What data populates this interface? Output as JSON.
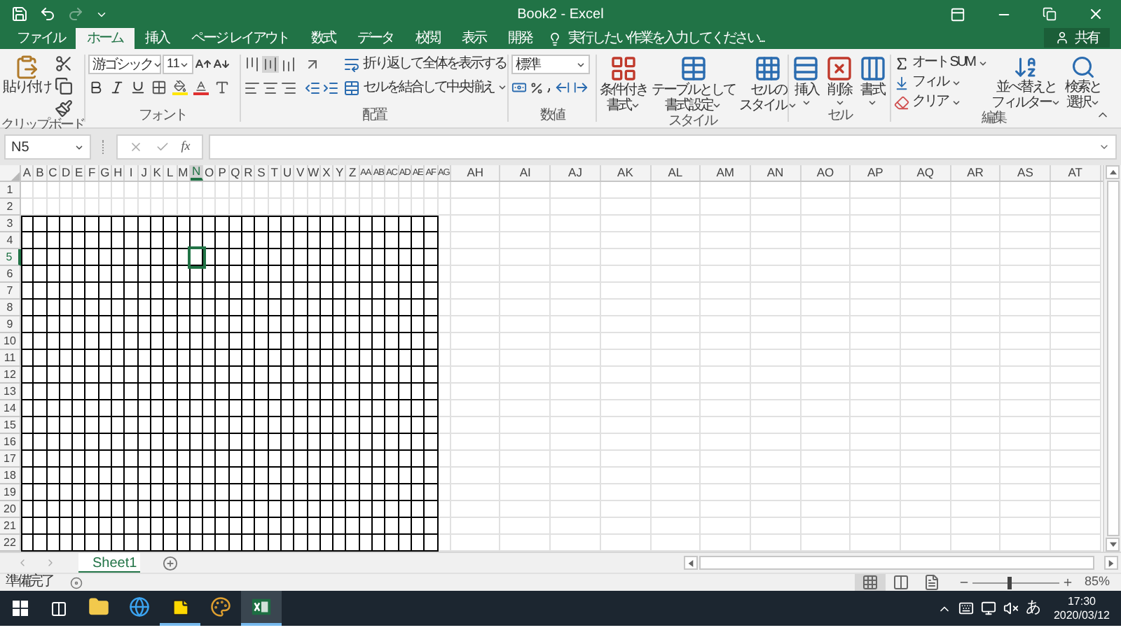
{
  "window": {
    "title": "Book2 - Excel"
  },
  "tabs": [
    {
      "label": "ファイル",
      "selected": false
    },
    {
      "label": "ホーム",
      "selected": true
    },
    {
      "label": "挿入",
      "selected": false
    },
    {
      "label": "ページ レイアウト",
      "selected": false
    },
    {
      "label": "数式",
      "selected": false
    },
    {
      "label": "データ",
      "selected": false
    },
    {
      "label": "校閲",
      "selected": false
    },
    {
      "label": "表示",
      "selected": false
    },
    {
      "label": "開発",
      "selected": false
    }
  ],
  "tell_me": {
    "placeholder": "実行したい作業を入力してください..."
  },
  "share": {
    "label": "共有"
  },
  "ribbon": {
    "clipboard": {
      "label": "クリップボード",
      "paste": "貼り付け"
    },
    "font": {
      "label": "フォント",
      "font_name": "游ゴシック",
      "font_size": "11"
    },
    "alignment": {
      "label": "配置",
      "wrap_text": "折り返して全体を表示する",
      "merge_center": "セルを結合して中央揃え"
    },
    "number": {
      "label": "数値",
      "format": "標準"
    },
    "styles": {
      "label": "スタイル",
      "buttons": [
        {
          "kind": "conditional",
          "lines": [
            "条件付き",
            "書式"
          ]
        },
        {
          "kind": "table",
          "lines": [
            "テーブルとして",
            "書式設定"
          ]
        },
        {
          "kind": "cell",
          "lines": [
            "セルの",
            "スタイル"
          ]
        }
      ]
    },
    "cells": {
      "label": "セル",
      "buttons": [
        {
          "kind": "insert",
          "label": "挿入"
        },
        {
          "kind": "delete",
          "label": "削除"
        },
        {
          "kind": "format",
          "label": "書式"
        }
      ]
    },
    "editing": {
      "label": "編集",
      "autosum": "オート SUM",
      "fill": "フィル",
      "clear": "クリア",
      "sort_filter": [
        "並べ替えと",
        "フィルター"
      ],
      "find_select": [
        "検索と",
        "選択"
      ]
    }
  },
  "name_box": {
    "value": "N5"
  },
  "formula_bar": {
    "fx": "fx"
  },
  "columns": [
    {
      "label": "A",
      "kind": "narrow",
      "selected": false,
      "bordered": true
    },
    {
      "label": "B",
      "kind": "narrow",
      "selected": false,
      "bordered": true
    },
    {
      "label": "C",
      "kind": "narrow",
      "selected": false,
      "bordered": true
    },
    {
      "label": "D",
      "kind": "narrow",
      "selected": false,
      "bordered": true
    },
    {
      "label": "E",
      "kind": "narrow",
      "selected": false,
      "bordered": true
    },
    {
      "label": "F",
      "kind": "narrow",
      "selected": false,
      "bordered": true
    },
    {
      "label": "G",
      "kind": "narrow",
      "selected": false,
      "bordered": true
    },
    {
      "label": "H",
      "kind": "narrow",
      "selected": false,
      "bordered": true
    },
    {
      "label": "I",
      "kind": "narrow",
      "selected": false,
      "bordered": true
    },
    {
      "label": "J",
      "kind": "narrow",
      "selected": false,
      "bordered": true
    },
    {
      "label": "K",
      "kind": "narrow",
      "selected": false,
      "bordered": true
    },
    {
      "label": "L",
      "kind": "narrow",
      "selected": false,
      "bordered": true
    },
    {
      "label": "M",
      "kind": "narrow",
      "selected": false,
      "bordered": true
    },
    {
      "label": "N",
      "kind": "narrow",
      "selected": true,
      "bordered": true
    },
    {
      "label": "O",
      "kind": "narrow",
      "selected": false,
      "bordered": true
    },
    {
      "label": "P",
      "kind": "narrow",
      "selected": false,
      "bordered": true
    },
    {
      "label": "Q",
      "kind": "narrow",
      "selected": false,
      "bordered": true
    },
    {
      "label": "R",
      "kind": "narrow",
      "selected": false,
      "bordered": true
    },
    {
      "label": "S",
      "kind": "narrow",
      "selected": false,
      "bordered": true
    },
    {
      "label": "T",
      "kind": "narrow",
      "selected": false,
      "bordered": true
    },
    {
      "label": "U",
      "kind": "narrow",
      "selected": false,
      "bordered": true
    },
    {
      "label": "V",
      "kind": "narrow",
      "selected": false,
      "bordered": true
    },
    {
      "label": "W",
      "kind": "narrow",
      "selected": false,
      "bordered": true
    },
    {
      "label": "X",
      "kind": "narrow",
      "selected": false,
      "bordered": true
    },
    {
      "label": "Y",
      "kind": "narrow",
      "selected": false,
      "bordered": true
    },
    {
      "label": "Z",
      "kind": "narrow",
      "selected": false,
      "bordered": true
    },
    {
      "label": "AA",
      "kind": "narrow",
      "selected": false,
      "bordered": true
    },
    {
      "label": "AB",
      "kind": "narrow",
      "selected": false,
      "bordered": true
    },
    {
      "label": "AC",
      "kind": "narrow",
      "selected": false,
      "bordered": true
    },
    {
      "label": "AD",
      "kind": "narrow",
      "selected": false,
      "bordered": true
    },
    {
      "label": "AE",
      "kind": "narrow",
      "selected": false,
      "bordered": true
    },
    {
      "label": "AF",
      "kind": "narrow",
      "selected": false,
      "bordered": true
    },
    {
      "label": "AG",
      "kind": "narrow",
      "selected": false,
      "bordered": false
    },
    {
      "label": "AH",
      "kind": "wide",
      "selected": false,
      "bordered": false
    },
    {
      "label": "AI",
      "kind": "wide",
      "selected": false,
      "bordered": false
    },
    {
      "label": "AJ",
      "kind": "wide",
      "selected": false,
      "bordered": false
    },
    {
      "label": "AK",
      "kind": "wide",
      "selected": false,
      "bordered": false
    },
    {
      "label": "AL",
      "kind": "wide",
      "selected": false,
      "bordered": false
    },
    {
      "label": "AM",
      "kind": "wide",
      "selected": false,
      "bordered": false
    },
    {
      "label": "AN",
      "kind": "wide",
      "selected": false,
      "bordered": false
    },
    {
      "label": "AO",
      "kind": "wide",
      "selected": false,
      "bordered": false
    },
    {
      "label": "AP",
      "kind": "wide",
      "selected": false,
      "bordered": false
    },
    {
      "label": "AQ",
      "kind": "wide",
      "selected": false,
      "bordered": false
    },
    {
      "label": "AR",
      "kind": "wide",
      "selected": false,
      "bordered": false
    },
    {
      "label": "AS",
      "kind": "wide",
      "selected": false,
      "bordered": false
    },
    {
      "label": "AT",
      "kind": "wide",
      "selected": false,
      "bordered": false
    }
  ],
  "rows": [
    {
      "label": "1",
      "selected": false,
      "bordered": false
    },
    {
      "label": "2",
      "selected": false,
      "bordered": false
    },
    {
      "label": "3",
      "selected": false,
      "bordered": true
    },
    {
      "label": "4",
      "selected": false,
      "bordered": true
    },
    {
      "label": "5",
      "selected": true,
      "bordered": true
    },
    {
      "label": "6",
      "selected": false,
      "bordered": true
    },
    {
      "label": "7",
      "selected": false,
      "bordered": true
    },
    {
      "label": "8",
      "selected": false,
      "bordered": true
    },
    {
      "label": "9",
      "selected": false,
      "bordered": true
    },
    {
      "label": "10",
      "selected": false,
      "bordered": true
    },
    {
      "label": "11",
      "selected": false,
      "bordered": true
    },
    {
      "label": "12",
      "selected": false,
      "bordered": true
    },
    {
      "label": "13",
      "selected": false,
      "bordered": true
    },
    {
      "label": "14",
      "selected": false,
      "bordered": true
    },
    {
      "label": "15",
      "selected": false,
      "bordered": true
    },
    {
      "label": "16",
      "selected": false,
      "bordered": true
    },
    {
      "label": "17",
      "selected": false,
      "bordered": true
    },
    {
      "label": "18",
      "selected": false,
      "bordered": true
    },
    {
      "label": "19",
      "selected": false,
      "bordered": true
    },
    {
      "label": "20",
      "selected": false,
      "bordered": true
    },
    {
      "label": "21",
      "selected": false,
      "bordered": true
    },
    {
      "label": "22",
      "selected": false,
      "bordered": true
    }
  ],
  "sheet_tabs": [
    {
      "label": "Sheet1",
      "selected": true
    }
  ],
  "status_bar": {
    "text": "準備完了",
    "views": [
      {
        "kind": "normal",
        "selected": true
      },
      {
        "kind": "page_layout",
        "selected": false
      },
      {
        "kind": "page_break",
        "selected": false
      }
    ],
    "zoom": {
      "level": 0.42,
      "reading": "85%"
    }
  },
  "taskbar": {
    "apps": [
      {
        "kind": "explorer",
        "running": false,
        "active": false
      },
      {
        "kind": "browser",
        "running": false,
        "active": false
      },
      {
        "kind": "sticky",
        "running": true,
        "active": false
      },
      {
        "kind": "paint",
        "running": false,
        "active": false
      },
      {
        "kind": "excel",
        "running": true,
        "active": true
      }
    ],
    "ime": "あ",
    "time": "17:30",
    "date": "2020/03/12"
  }
}
